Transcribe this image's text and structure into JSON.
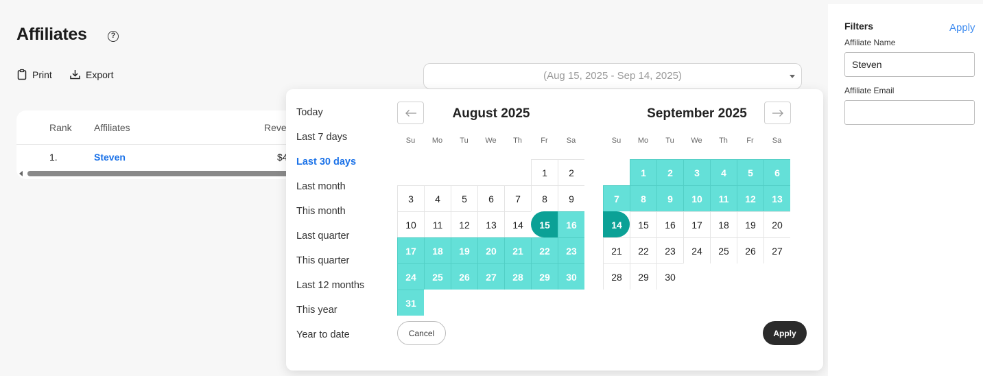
{
  "page": {
    "title": "Affiliates",
    "help_icon": "question-circle-icon"
  },
  "toolbar": {
    "print_label": "Print",
    "print_icon": "clipboard-icon",
    "export_label": "Export",
    "export_icon": "download-icon"
  },
  "table": {
    "columns": [
      "Rank",
      "Affiliates",
      "Reve"
    ],
    "rows": [
      {
        "rank": "1.",
        "affiliate": "Steven",
        "revenue": "$4"
      }
    ]
  },
  "date_range": {
    "value": "(Aug 15, 2025 - Sep 14, 2025)"
  },
  "presets": [
    "Today",
    "Last 7 days",
    "Last 30 days",
    "Last month",
    "This month",
    "Last quarter",
    "This quarter",
    "Last 12 months",
    "This year",
    "Year to date"
  ],
  "active_preset": "Last 30 days",
  "calendar": {
    "weekdays": [
      "Su",
      "Mo",
      "Tu",
      "We",
      "Th",
      "Fr",
      "Sa"
    ],
    "range_start": "2025-08-15",
    "range_end": "2025-09-14",
    "months": [
      {
        "title": "August 2025",
        "year": 2025,
        "month": 8,
        "first_weekday": 5,
        "days": 31
      },
      {
        "title": "September 2025",
        "year": 2025,
        "month": 9,
        "first_weekday": 1,
        "days": 30
      }
    ],
    "prev_icon": "arrow-left-icon",
    "next_icon": "arrow-right-icon"
  },
  "buttons": {
    "cancel": "Cancel",
    "apply": "Apply"
  },
  "filters": {
    "title": "Filters",
    "apply": "Apply",
    "name_label": "Affiliate Name",
    "name_value": "Steven",
    "email_label": "Affiliate Email",
    "email_value": ""
  },
  "colors": {
    "range": "#64e0d8",
    "range_edge": "#0ba196",
    "link": "#1b72e8",
    "apply_bg": "#2b2b2b"
  }
}
